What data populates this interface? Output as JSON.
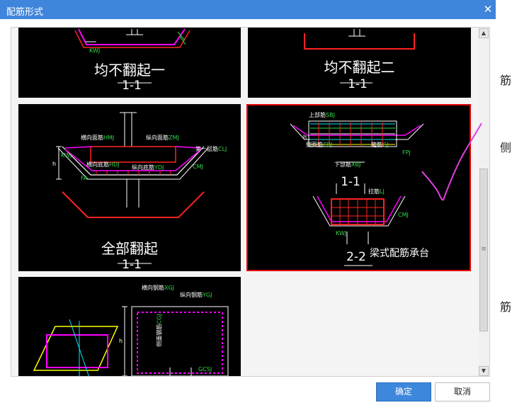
{
  "dialog": {
    "title": "配筋形式"
  },
  "buttons": {
    "ok": "确定",
    "cancel": "取消"
  },
  "cards": [
    {
      "caption": "均不翻起一",
      "section": "1-1",
      "labels": {
        "kwj": "KWJ"
      }
    },
    {
      "caption": "均不翻起二",
      "section": "1-1"
    },
    {
      "caption": "全部翻起",
      "section": "1-1",
      "labels": {
        "heng_mian": "横向面筋",
        "heng_mian_code": "HMJ",
        "zong_mian": "纵向面筋",
        "zong_mian_code": "ZMJ",
        "ceng_jiao": "第一层筋",
        "ceng_jiao_code": "CLJ",
        "heng_di": "横向底筋",
        "heng_di_code": "HDJ",
        "zong_di": "纵向底筋",
        "zong_di_code": "YDJ",
        "fa": "FA",
        "kwj": "KWJ",
        "cmj": "CMJ",
        "h": "h"
      }
    },
    {
      "caption": "梁式配筋承台",
      "section_a": "1-1",
      "section_b": "2-2",
      "selected": true,
      "labels": {
        "shang": "上部筋",
        "shang_code": "SBJ",
        "ce": "侧面筋",
        "ce_code": "CBJ",
        "gu": "箍筋",
        "gu_code": "GJ",
        "xia": "下部筋",
        "xia_code": "XBJ",
        "la": "拉筋",
        "la_code": "LJ",
        "fpj": "FPJ",
        "kwj": "KWJ",
        "cmj": "CMJ",
        "h": "h"
      }
    },
    {
      "labels": {
        "heng": "横向钢筋",
        "heng_code": "XGJ",
        "zong": "纵向钢筋",
        "zong_code": "YGJ",
        "ce": "侧面钢筋",
        "ce_code": "CGJ",
        "h": "h",
        "gcsj": "GCSJ"
      }
    }
  ]
}
